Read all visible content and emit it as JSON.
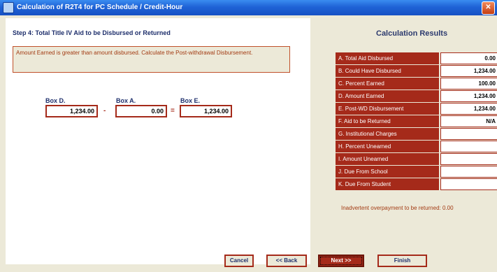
{
  "window": {
    "title": "Calculation of R2T4 for PC Schedule / Credit-Hour"
  },
  "step": {
    "title": "Step 4: Total Title IV Aid to be Disbursed or Returned",
    "message": "Amount Earned is greater than amount disbursed.  Calculate the Post-withdrawal Disbursement."
  },
  "boxes": {
    "d": {
      "label": "Box D.",
      "value": "1,234.00"
    },
    "a": {
      "label": "Box A.",
      "value": "0.00"
    },
    "e": {
      "label": "Box E.",
      "value": "1,234.00"
    },
    "minus": "-",
    "equals": "="
  },
  "results": {
    "title": "Calculation Results",
    "rows": [
      {
        "label": "A. Total Aid Disbursed",
        "value": "0.00"
      },
      {
        "label": "B. Could Have Disbursed",
        "value": "1,234.00"
      },
      {
        "label": "C. Percent Earned",
        "value": "100.00"
      },
      {
        "label": "D. Amount Earned",
        "value": "1,234.00"
      },
      {
        "label": "E. Post-WD Disbursement",
        "value": "1,234.00"
      },
      {
        "label": "F. Aid to be Returned",
        "value": "N/A"
      },
      {
        "label": "G. Institutional Charges",
        "value": ""
      },
      {
        "label": "H. Percent Unearned",
        "value": ""
      },
      {
        "label": "I. Amount Unearned",
        "value": ""
      },
      {
        "label": "J. Due From School",
        "value": ""
      },
      {
        "label": "K. Due From Student",
        "value": ""
      }
    ],
    "inadvertent": "Inadvertent overpayment to be returned: 0.00"
  },
  "buttons": {
    "cancel": "Cancel",
    "back": "<< Back",
    "next": "Next >>",
    "finish": "Finish"
  },
  "colors": {
    "titlebar": "#1f63d6",
    "accent": "#a52a1a",
    "heading": "#1d2e6b",
    "panel": "#ece9d8"
  }
}
